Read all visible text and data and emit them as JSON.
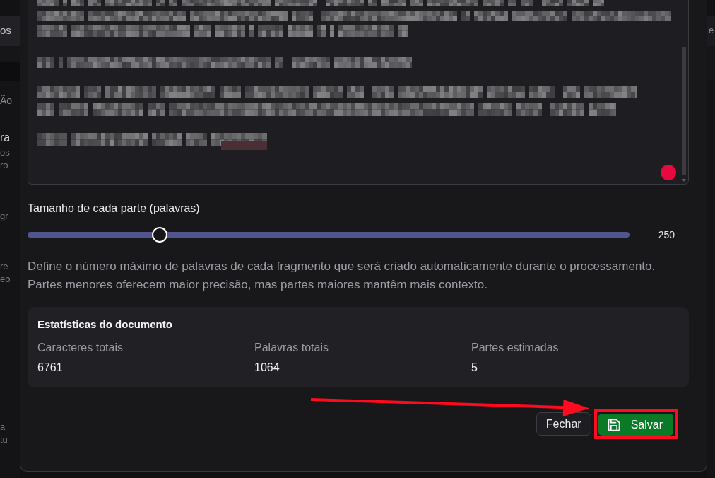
{
  "background_page": {
    "left_edge_fragments": [
      "os",
      "Ão",
      "ra",
      "os",
      "ro",
      "gr",
      "re",
      "eo",
      "a",
      "tu"
    ],
    "right_edge_fragments": [
      "e"
    ]
  },
  "document_editor": {
    "content_redacted": true
  },
  "chunk_size": {
    "label": "Tamanho de cada parte (palavras)",
    "level": 0.22,
    "reading": "250",
    "description": "Define o número máximo de palavras de cada fragmento que será criado automaticamente durante o processamento. Partes menores oferecem maior precisão, mas partes maiores mantêm mais contexto."
  },
  "statistics": {
    "title": "Estatísticas do documento",
    "items": [
      {
        "label": "Caracteres totais",
        "value": "6761"
      },
      {
        "label": "Palavras totais",
        "value": "1064"
      },
      {
        "label": "Partes estimadas",
        "value": "5"
      }
    ]
  },
  "buttons": [
    {
      "label": "Fechar",
      "kind": "secondary",
      "highlighted": false
    },
    {
      "label": "Salvar",
      "kind": "primary",
      "highlighted": true
    }
  ]
}
